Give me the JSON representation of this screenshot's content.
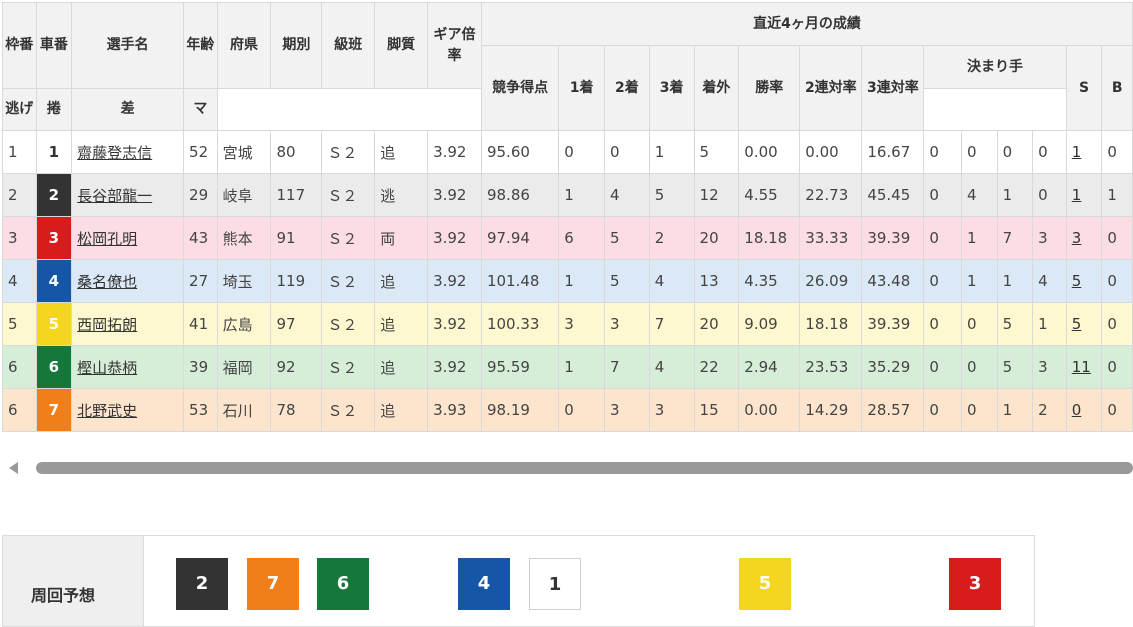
{
  "table": {
    "headers": {
      "waku": "枠番",
      "sha": "車番",
      "name": "選手名",
      "age": "年齢",
      "pref": "府県",
      "term": "期別",
      "class": "級班",
      "leg": "脚質",
      "gear": "ギア倍率",
      "recent": "直近4ヶ月の成績",
      "score": "競争得点",
      "first": "1着",
      "second": "2着",
      "third": "3着",
      "out": "着外",
      "winrate": "勝率",
      "rate2": "2連対率",
      "rate3": "3連対率",
      "kimarite": "決まり手",
      "nige": "逃げ",
      "makuri": "捲",
      "sashi": "差",
      "ma": "マ",
      "s": "S",
      "b": "B"
    },
    "rows": [
      {
        "waku": "1",
        "car": "1",
        "name": "齋藤登志信",
        "age": "52",
        "pref": "宮城",
        "term": "80",
        "class": "Ｓ２",
        "leg": "追",
        "gear": "3.92",
        "score": "95.60",
        "first": "0",
        "second": "0",
        "third": "1",
        "out": "5",
        "winrate": "0.00",
        "rate2": "0.00",
        "rate3": "16.67",
        "nige": "0",
        "makuri": "0",
        "sashi": "0",
        "ma": "0",
        "s": "1",
        "b": "0",
        "car_bg": "#ffffff",
        "car_fg": "#333333",
        "row_bg": "#ffffff"
      },
      {
        "waku": "2",
        "car": "2",
        "name": "長谷部龍一",
        "age": "29",
        "pref": "岐阜",
        "term": "117",
        "class": "Ｓ２",
        "leg": "逃",
        "gear": "3.92",
        "score": "98.86",
        "first": "1",
        "second": "4",
        "third": "5",
        "out": "12",
        "winrate": "4.55",
        "rate2": "22.73",
        "rate3": "45.45",
        "nige": "0",
        "makuri": "4",
        "sashi": "1",
        "ma": "0",
        "s": "1",
        "b": "1",
        "car_bg": "#333333",
        "car_fg": "#ffffff",
        "row_bg": "#ebebeb"
      },
      {
        "waku": "3",
        "car": "3",
        "name": "松岡孔明",
        "age": "43",
        "pref": "熊本",
        "term": "91",
        "class": "Ｓ２",
        "leg": "両",
        "gear": "3.92",
        "score": "97.94",
        "first": "6",
        "second": "5",
        "third": "2",
        "out": "20",
        "winrate": "18.18",
        "rate2": "33.33",
        "rate3": "39.39",
        "nige": "0",
        "makuri": "1",
        "sashi": "7",
        "ma": "3",
        "s": "3",
        "b": "0",
        "car_bg": "#d81b1b",
        "car_fg": "#ffffff",
        "row_bg": "#fbdde3"
      },
      {
        "waku": "4",
        "car": "4",
        "name": "桑名僚也",
        "age": "27",
        "pref": "埼玉",
        "term": "119",
        "class": "Ｓ２",
        "leg": "追",
        "gear": "3.92",
        "score": "101.48",
        "first": "1",
        "second": "5",
        "third": "4",
        "out": "13",
        "winrate": "4.35",
        "rate2": "26.09",
        "rate3": "43.48",
        "nige": "0",
        "makuri": "1",
        "sashi": "1",
        "ma": "4",
        "s": "5",
        "b": "0",
        "car_bg": "#1556a6",
        "car_fg": "#ffffff",
        "row_bg": "#dbe8f6"
      },
      {
        "waku": "5",
        "car": "5",
        "name": "西岡拓朗",
        "age": "41",
        "pref": "広島",
        "term": "97",
        "class": "Ｓ２",
        "leg": "追",
        "gear": "3.92",
        "score": "100.33",
        "first": "3",
        "second": "3",
        "third": "7",
        "out": "20",
        "winrate": "9.09",
        "rate2": "18.18",
        "rate3": "39.39",
        "nige": "0",
        "makuri": "0",
        "sashi": "5",
        "ma": "1",
        "s": "5",
        "b": "0",
        "car_bg": "#f5d61f",
        "car_fg": "#ffffff",
        "row_bg": "#fdf8cf"
      },
      {
        "waku": "6",
        "car": "6",
        "name": "樫山恭柄",
        "age": "39",
        "pref": "福岡",
        "term": "92",
        "class": "Ｓ２",
        "leg": "追",
        "gear": "3.92",
        "score": "95.59",
        "first": "1",
        "second": "7",
        "third": "4",
        "out": "22",
        "winrate": "2.94",
        "rate2": "23.53",
        "rate3": "35.29",
        "nige": "0",
        "makuri": "0",
        "sashi": "5",
        "ma": "3",
        "s": "11",
        "b": "0",
        "car_bg": "#15783a",
        "car_fg": "#ffffff",
        "row_bg": "#d6eed7"
      },
      {
        "waku": "6",
        "car": "7",
        "name": "北野武史",
        "age": "53",
        "pref": "石川",
        "term": "78",
        "class": "Ｓ２",
        "leg": "追",
        "gear": "3.93",
        "score": "98.19",
        "first": "0",
        "second": "3",
        "third": "3",
        "out": "15",
        "winrate": "0.00",
        "rate2": "14.29",
        "rate3": "28.57",
        "nige": "0",
        "makuri": "0",
        "sashi": "1",
        "ma": "2",
        "s": "0",
        "b": "0",
        "car_bg": "#f07f1a",
        "car_fg": "#ffffff",
        "row_bg": "#fde4cc"
      }
    ]
  },
  "forecast": {
    "label": "周回予想",
    "boxes": [
      {
        "num": "2",
        "bg": "#333333",
        "fg": "#ffffff"
      },
      {
        "num": "7",
        "bg": "#f07f1a",
        "fg": "#ffffff"
      },
      {
        "num": "6",
        "bg": "#15783a",
        "fg": "#ffffff"
      },
      {
        "num": "4",
        "bg": "#1556a6",
        "fg": "#ffffff"
      },
      {
        "num": "1",
        "bg": "#ffffff",
        "fg": "#333333"
      },
      {
        "num": "5",
        "bg": "#f5d61f",
        "fg": "#ffffff"
      },
      {
        "num": "3",
        "bg": "#d81b1b",
        "fg": "#ffffff"
      }
    ]
  }
}
